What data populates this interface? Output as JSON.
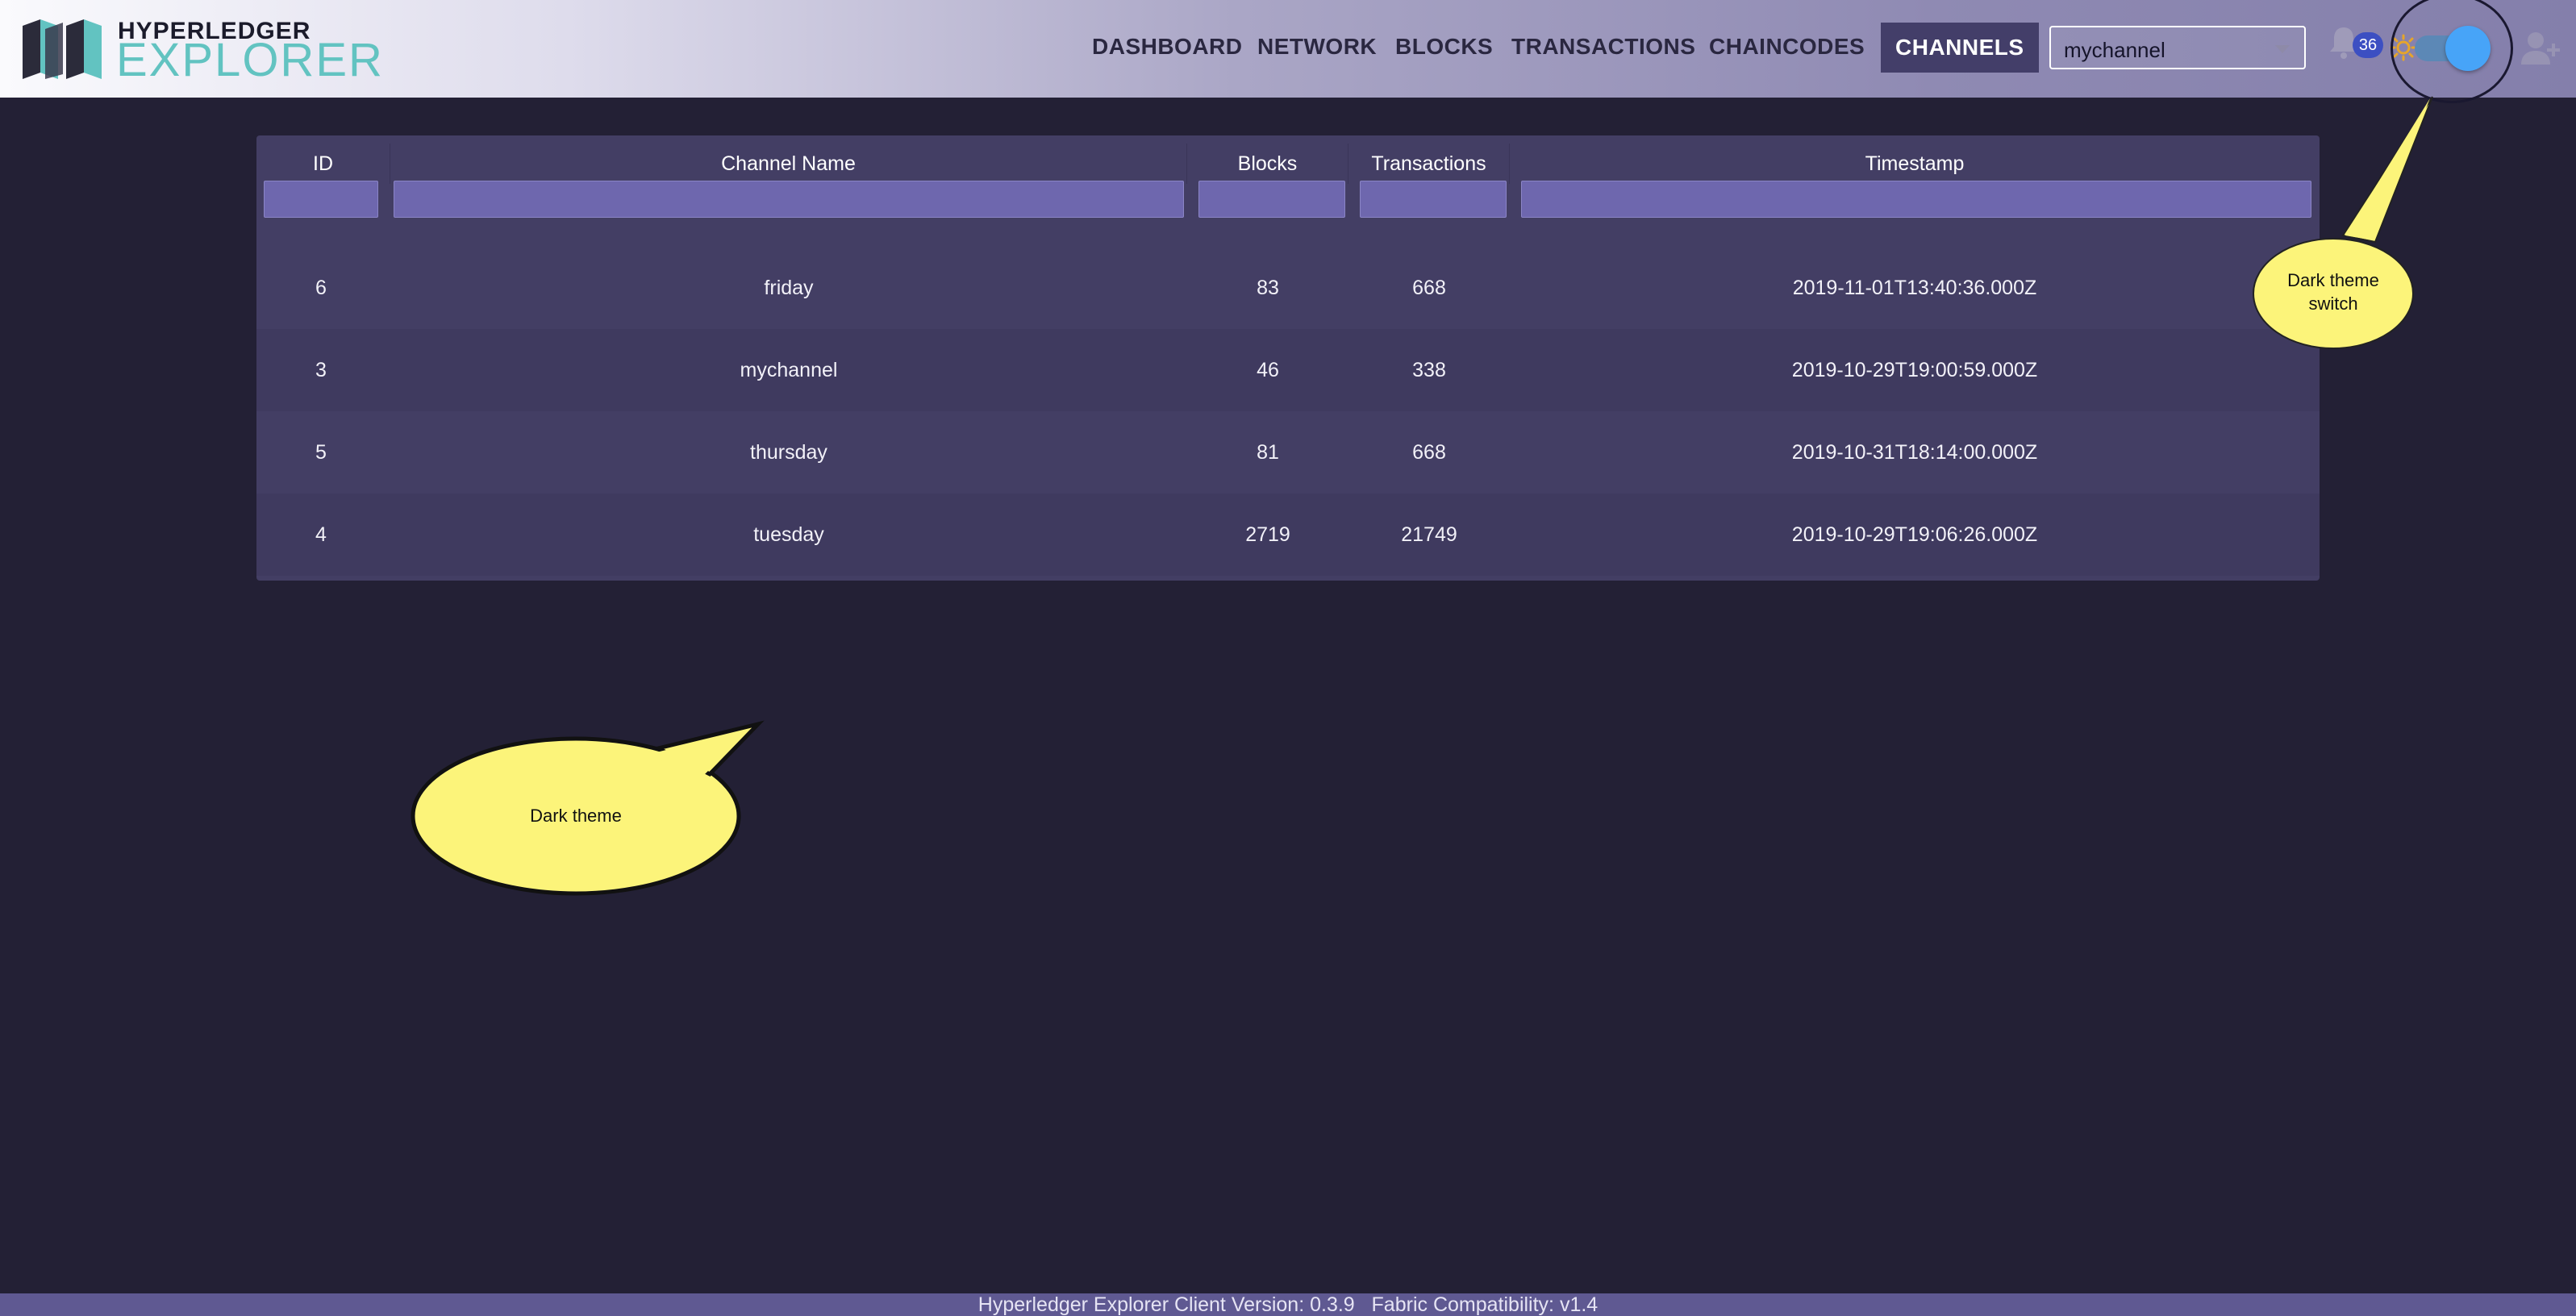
{
  "app": {
    "logo_top": "HYPERLEDGER",
    "logo_bottom": "EXPLORER"
  },
  "nav": {
    "items": [
      {
        "label": "DASHBOARD"
      },
      {
        "label": "NETWORK"
      },
      {
        "label": "BLOCKS"
      },
      {
        "label": "TRANSACTIONS"
      },
      {
        "label": "CHAINCODES"
      },
      {
        "label": "CHANNELS",
        "active": true
      }
    ],
    "channel_select": {
      "value": "mychannel"
    },
    "notifications": {
      "icon": "bell-icon",
      "count": "36"
    },
    "theme_toggle": {
      "icon": "sun-icon",
      "dark_mode": true
    },
    "user": {
      "icon": "add-user-icon"
    }
  },
  "table": {
    "columns": [
      "ID",
      "Channel Name",
      "Blocks",
      "Transactions",
      "Timestamp"
    ],
    "rows": [
      {
        "id": "6",
        "channel_name": "friday",
        "blocks": "83",
        "transactions": "668",
        "timestamp": "2019-11-01T13:40:36.000Z"
      },
      {
        "id": "3",
        "channel_name": "mychannel",
        "blocks": "46",
        "transactions": "338",
        "timestamp": "2019-10-29T19:00:59.000Z"
      },
      {
        "id": "5",
        "channel_name": "thursday",
        "blocks": "81",
        "transactions": "668",
        "timestamp": "2019-10-31T18:14:00.000Z"
      },
      {
        "id": "4",
        "channel_name": "tuesday",
        "blocks": "2719",
        "transactions": "21749",
        "timestamp": "2019-10-29T19:06:26.000Z"
      }
    ]
  },
  "callouts": {
    "toggle_note_line1": "Dark theme",
    "toggle_note_line2": "switch",
    "theme_note": "Dark theme"
  },
  "footer": {
    "text": "Hyperledger Explorer Client Version: 0.3.9   Fabric Compatibility: v1.4"
  },
  "colors": {
    "background": "#232035",
    "table": "#433e64",
    "active_nav": "#433e69",
    "filter": "#6e67ae",
    "accent": "#47a4f8",
    "callout": "#fcf47a"
  }
}
